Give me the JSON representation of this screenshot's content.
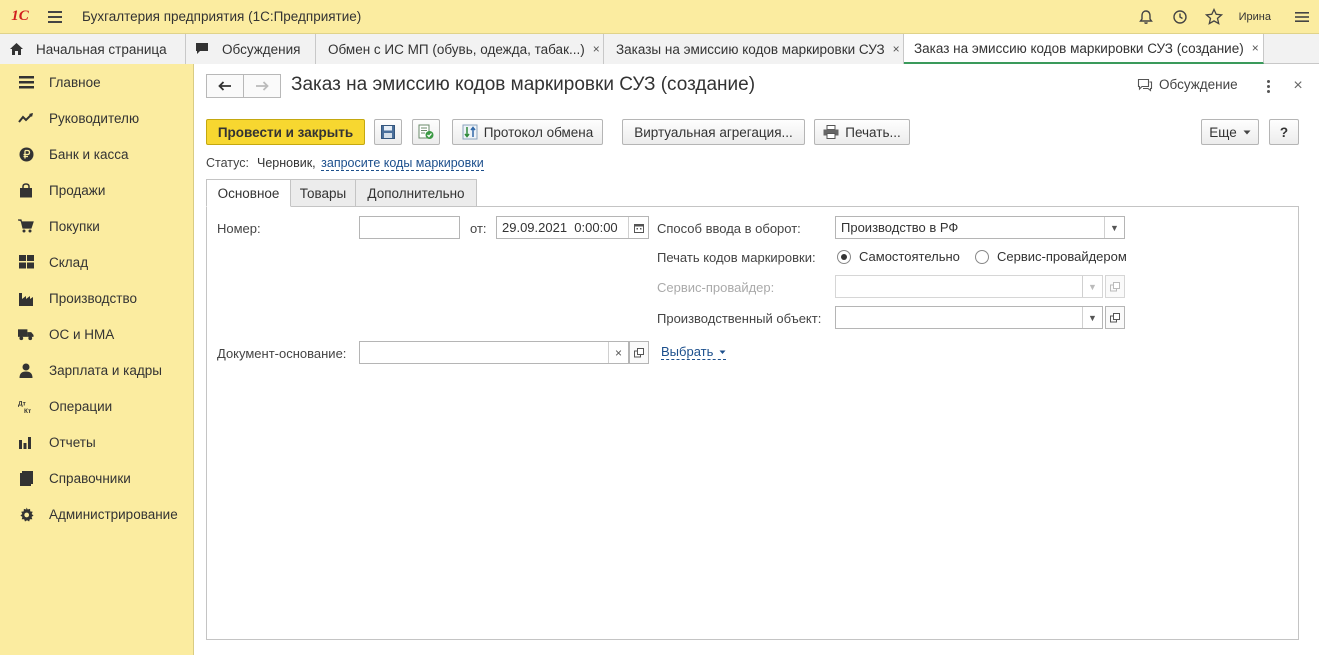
{
  "app": {
    "logo": "1С",
    "title": "Бухгалтерия предприятия (1С:Предприятие)",
    "user": "Ирина"
  },
  "tabs": [
    {
      "label": "Начальная страница",
      "closable": false,
      "icon": "home-icon"
    },
    {
      "label": "Обсуждения",
      "closable": false,
      "icon": "chat-icon"
    },
    {
      "label": "Обмен с ИС МП (обувь, одежда, табак...)",
      "closable": true
    },
    {
      "label": "Заказы на эмиссию кодов маркировки СУЗ",
      "closable": true
    },
    {
      "label": "Заказ на эмиссию кодов маркировки СУЗ (создание)",
      "closable": true,
      "active": true
    }
  ],
  "close_glyph": "×",
  "sidebar": {
    "items": [
      {
        "label": "Главное",
        "icon": "menu-lines-icon"
      },
      {
        "label": "Руководителю",
        "icon": "trend-icon"
      },
      {
        "label": "Банк и касса",
        "icon": "ruble-coin-icon"
      },
      {
        "label": "Продажи",
        "icon": "shopping-bag-icon"
      },
      {
        "label": "Покупки",
        "icon": "cart-icon"
      },
      {
        "label": "Склад",
        "icon": "warehouse-grid-icon"
      },
      {
        "label": "Производство",
        "icon": "factory-icon"
      },
      {
        "label": "ОС и НМА",
        "icon": "truck-icon"
      },
      {
        "label": "Зарплата и кадры",
        "icon": "person-icon"
      },
      {
        "label": "Операции",
        "icon": "dt-kt-icon"
      },
      {
        "label": "Отчеты",
        "icon": "bar-chart-icon"
      },
      {
        "label": "Справочники",
        "icon": "book-icon"
      },
      {
        "label": "Администрирование",
        "icon": "gear-icon"
      }
    ]
  },
  "document": {
    "title": "Заказ на эмиссию кодов маркировки СУЗ (создание)",
    "discussion_label": "Обсуждение"
  },
  "toolbar": {
    "post_close": "Провести и закрыть",
    "exchange_protocol": "Протокол обмена",
    "virtual_aggregation": "Виртуальная агрегация...",
    "print": "Печать...",
    "more": "Еще",
    "help": "?"
  },
  "status": {
    "label": "Статус:",
    "value": "Черновик,",
    "link": "запросите коды маркировки"
  },
  "form_tabs": [
    {
      "label": "Основное",
      "active": true
    },
    {
      "label": "Товары"
    },
    {
      "label": "Дополнительно"
    }
  ],
  "form": {
    "number_label": "Номер:",
    "number_value": "",
    "from_label": "от:",
    "date_value": "29.09.2021  0:00:00",
    "input_method_label": "Способ ввода в оборот:",
    "input_method_value": "Производство в РФ",
    "print_codes_label": "Печать кодов маркировки:",
    "radio_self": "Самостоятельно",
    "radio_provider": "Сервис-провайдером",
    "radio_selected": "self",
    "service_provider_label": "Сервис-провайдер:",
    "service_provider_value": "",
    "production_object_label": "Производственный объект:",
    "production_object_value": "",
    "base_document_label": "Документ-основание:",
    "base_document_value": "",
    "select_link": "Выбрать"
  },
  "colors": {
    "accent_yellow": "#f7d730",
    "sidebar_bg": "#fbeca0",
    "link": "#1c4f8c",
    "active_tab_underline": "#3a9a5b"
  }
}
